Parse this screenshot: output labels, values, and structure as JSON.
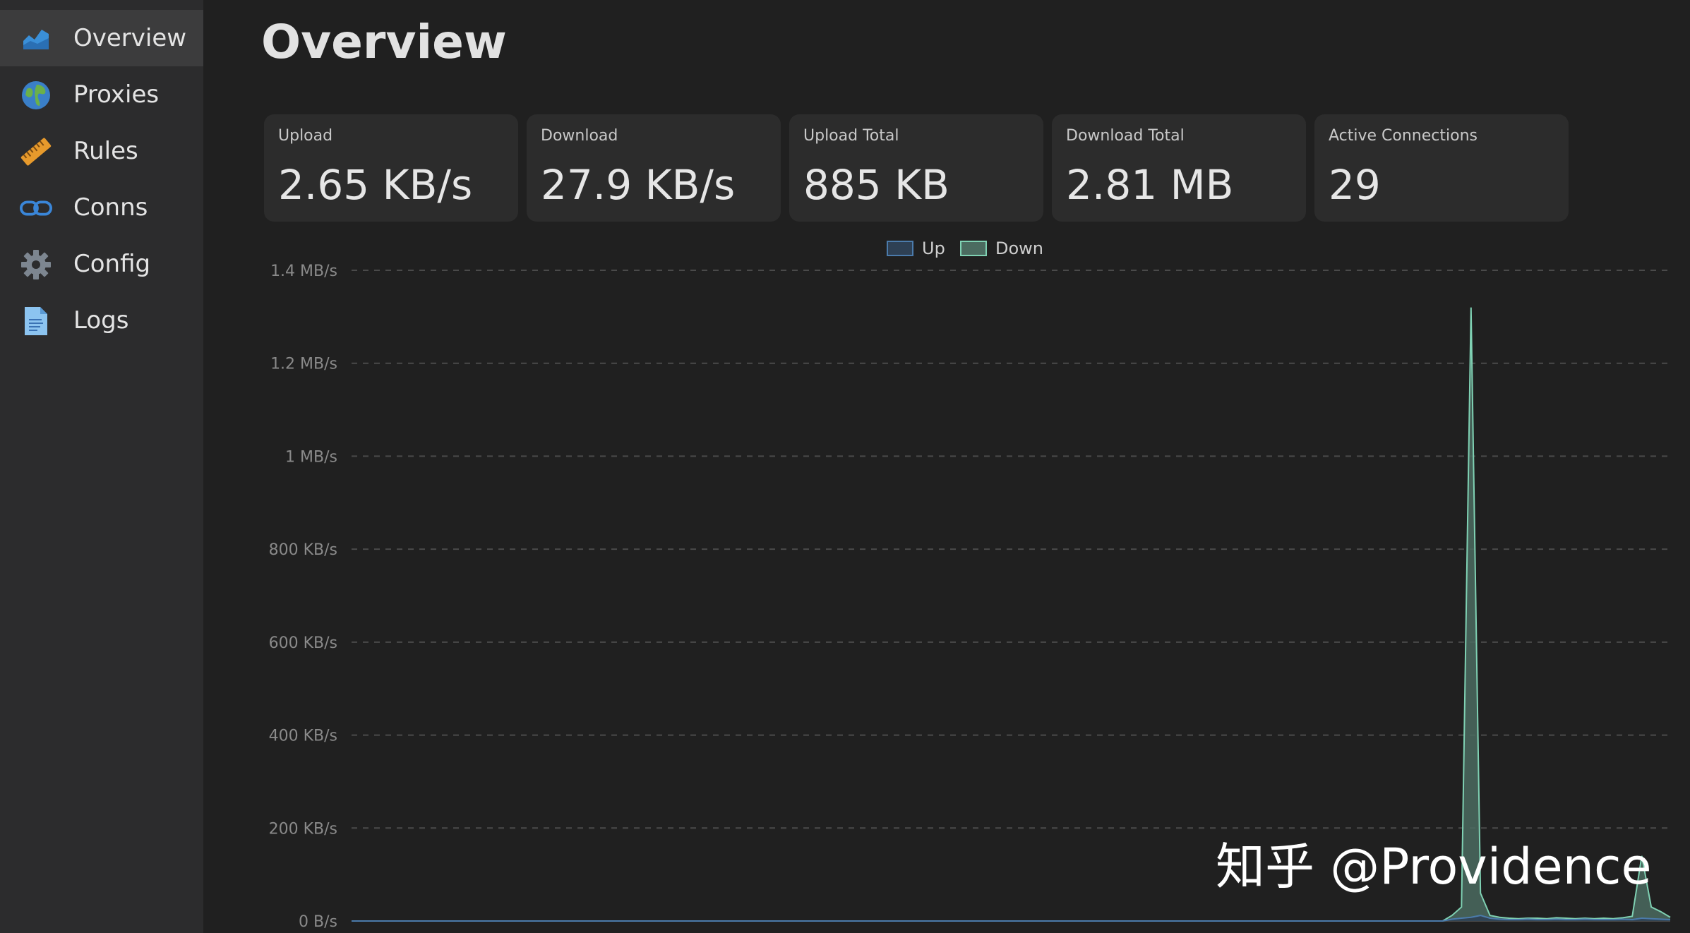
{
  "sidebar": {
    "items": [
      {
        "label": "Overview",
        "icon": "area-chart-icon",
        "active": true
      },
      {
        "label": "Proxies",
        "icon": "globe-icon",
        "active": false
      },
      {
        "label": "Rules",
        "icon": "ruler-icon",
        "active": false
      },
      {
        "label": "Conns",
        "icon": "link-icon",
        "active": false
      },
      {
        "label": "Config",
        "icon": "gear-icon",
        "active": false
      },
      {
        "label": "Logs",
        "icon": "document-icon",
        "active": false
      }
    ]
  },
  "main": {
    "title": "Overview",
    "stats": [
      {
        "label": "Upload",
        "value": "2.65 KB/s"
      },
      {
        "label": "Download",
        "value": "27.9 KB/s"
      },
      {
        "label": "Upload Total",
        "value": "885 KB"
      },
      {
        "label": "Download Total",
        "value": "2.81 MB"
      },
      {
        "label": "Active Connections",
        "value": "29"
      }
    ]
  },
  "chart_data": {
    "type": "area",
    "title": "",
    "xlabel": "",
    "ylabel": "",
    "ylim": [
      0,
      1.4
    ],
    "y_unit": "MB/s",
    "y_tick_labels": [
      "0 B/s",
      "200 KB/s",
      "400 KB/s",
      "600 KB/s",
      "800 KB/s",
      "1 MB/s",
      "1.2 MB/s",
      "1.4 MB/s"
    ],
    "grid": true,
    "legend_position": "top-center",
    "series": [
      {
        "name": "Up",
        "color": "#4b7bab",
        "fill": "#2e4054",
        "values": [
          0,
          0,
          0,
          0,
          0,
          0,
          0,
          0,
          0,
          0,
          0,
          0,
          0,
          0,
          0,
          0,
          0,
          0,
          0,
          0,
          0,
          0,
          0,
          0,
          0,
          0,
          0,
          0,
          0,
          0,
          0,
          0,
          0,
          0,
          0,
          0,
          0,
          0,
          0,
          0,
          0,
          0,
          0,
          0,
          0,
          0,
          0,
          0,
          0,
          0,
          0,
          0,
          0,
          0,
          0,
          0,
          0,
          0,
          0,
          0,
          0,
          0,
          0,
          0,
          0,
          0,
          0,
          0,
          0,
          0,
          0,
          0,
          0,
          0,
          0,
          0,
          0,
          0,
          0,
          0,
          0,
          0,
          0,
          0,
          0,
          0,
          0,
          0,
          0,
          0,
          0,
          0,
          0,
          0,
          0,
          0,
          0,
          0,
          0,
          0,
          0,
          0,
          0,
          0,
          0,
          0,
          0,
          0,
          0,
          0,
          0,
          0,
          0,
          0,
          0,
          0,
          0.004,
          0.006,
          0.008,
          0.012,
          0.006,
          0.004,
          0.003,
          0.003,
          0.004,
          0.003,
          0.003,
          0.004,
          0.003,
          0.003,
          0.004,
          0.003,
          0.003,
          0.003,
          0.004,
          0.003,
          0.006,
          0.005,
          0.004,
          0.003
        ]
      },
      {
        "name": "Down",
        "color": "#7fd1b3",
        "fill": "#4b6b60",
        "values": [
          0,
          0,
          0,
          0,
          0,
          0,
          0,
          0,
          0,
          0,
          0,
          0,
          0,
          0,
          0,
          0,
          0,
          0,
          0,
          0,
          0,
          0,
          0,
          0,
          0,
          0,
          0,
          0,
          0,
          0,
          0,
          0,
          0,
          0,
          0,
          0,
          0,
          0,
          0,
          0,
          0,
          0,
          0,
          0,
          0,
          0,
          0,
          0,
          0,
          0,
          0,
          0,
          0,
          0,
          0,
          0,
          0,
          0,
          0,
          0,
          0,
          0,
          0,
          0,
          0,
          0,
          0,
          0,
          0,
          0,
          0,
          0,
          0,
          0,
          0,
          0,
          0,
          0,
          0,
          0,
          0,
          0,
          0,
          0,
          0,
          0,
          0,
          0,
          0,
          0,
          0,
          0,
          0,
          0,
          0,
          0,
          0,
          0,
          0,
          0,
          0,
          0,
          0,
          0,
          0,
          0,
          0,
          0,
          0,
          0,
          0,
          0,
          0,
          0,
          0,
          0,
          0.012,
          0.03,
          1.32,
          0.06,
          0.012,
          0.008,
          0.006,
          0.005,
          0.006,
          0.006,
          0.005,
          0.007,
          0.006,
          0.005,
          0.006,
          0.005,
          0.006,
          0.005,
          0.007,
          0.01,
          0.14,
          0.03,
          0.02,
          0.008
        ]
      }
    ]
  },
  "watermark": {
    "text": "知乎 @Providence"
  },
  "colors": {
    "background": "#202020",
    "sidebar": "#2c2c2d",
    "sidebar_active": "#3c3c3d",
    "card": "#2c2c2c",
    "grid": "#4a4a4a",
    "tick_text": "#8a8a8a"
  }
}
